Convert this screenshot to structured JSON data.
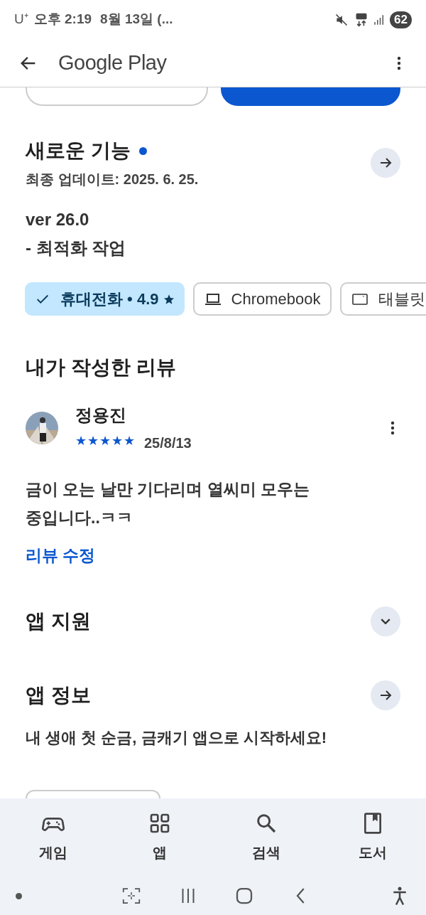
{
  "status_bar": {
    "carrier": "U⁺",
    "time": "오후 2:19",
    "date": "8월 13일 (...",
    "battery": "62"
  },
  "app_bar": {
    "title": "Google Play"
  },
  "whats_new": {
    "title": "새로운 기능",
    "updated": "최종 업데이트: 2025. 6. 25.",
    "notes": [
      "ver 26.0",
      "- 최적화 작업"
    ]
  },
  "device_chips": [
    {
      "kind": "phone",
      "label": "휴대전화 • 4.9",
      "selected": true
    },
    {
      "kind": "laptop",
      "label": "Chromebook",
      "selected": false
    },
    {
      "kind": "tablet",
      "label": "태블릿",
      "selected": false
    }
  ],
  "my_review": {
    "title": "내가 작성한 리뷰",
    "author": "정용진",
    "stars": 5,
    "date": "25/8/13",
    "text": "금이 오는 날만 기다리며 열씨미 모우는 중입니다..ㅋㅋ",
    "edit_link": "리뷰 수정"
  },
  "sections": [
    {
      "title": "앱 지원",
      "kind": "expand"
    },
    {
      "title": "앱 정보",
      "kind": "arrow"
    }
  ],
  "app_description": "내 생애 첫 순금, 금캐기 앱으로 시작하세요!",
  "bottom_nav": [
    {
      "kind": "games",
      "label": "게임"
    },
    {
      "kind": "apps",
      "label": "앱"
    },
    {
      "kind": "search",
      "label": "검색"
    },
    {
      "kind": "books",
      "label": "도서"
    }
  ]
}
